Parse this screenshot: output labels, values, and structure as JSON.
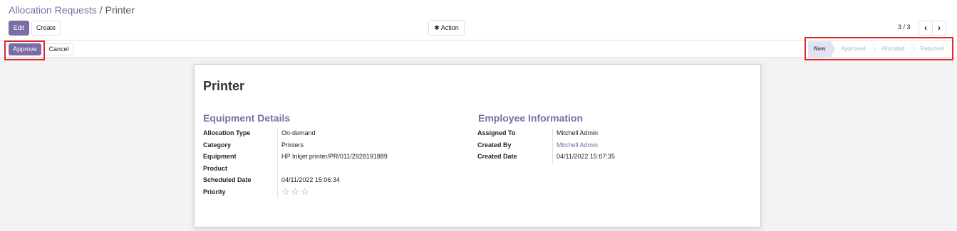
{
  "breadcrumb": {
    "parent": "Allocation Requests",
    "separator": "/",
    "current": "Printer"
  },
  "toolbar": {
    "edit_label": "Edit",
    "create_label": "Create",
    "action_label": "Action",
    "action_icon": "gear-icon"
  },
  "pager": {
    "value": "3 / 3",
    "prev_icon": "chevron-left-icon",
    "next_icon": "chevron-right-icon"
  },
  "statusbar": {
    "approve_label": "Approve",
    "cancel_label": "Cancel",
    "stages": [
      {
        "label": "New",
        "active": true
      },
      {
        "label": "Approved",
        "active": false
      },
      {
        "label": "Allocated",
        "active": false
      },
      {
        "label": "Returned",
        "active": false
      }
    ]
  },
  "record": {
    "title": "Printer",
    "equipment_details": {
      "heading": "Equipment Details",
      "fields": [
        {
          "label": "Allocation Type",
          "value": "On-demand"
        },
        {
          "label": "Category",
          "value": "Printers"
        },
        {
          "label": "Equipment",
          "value": "HP Inkjet printer/PR/011/2928191889"
        },
        {
          "label": "Product",
          "value": ""
        },
        {
          "label": "Scheduled Date",
          "value": "04/11/2022 15:06:34"
        },
        {
          "label": "Priority",
          "value": "☆☆☆"
        }
      ]
    },
    "employee_information": {
      "heading": "Employee Information",
      "fields": [
        {
          "label": "Assigned To",
          "value": "Mitchell Admin"
        },
        {
          "label": "Created By",
          "value": "Mitchell Admin"
        },
        {
          "label": "Created Date",
          "value": "04/11/2022 15:07:35"
        }
      ]
    }
  },
  "colors": {
    "brand": "#7c6ba6",
    "highlight": "#e1262d",
    "active_stage": "#e2e2f0"
  }
}
